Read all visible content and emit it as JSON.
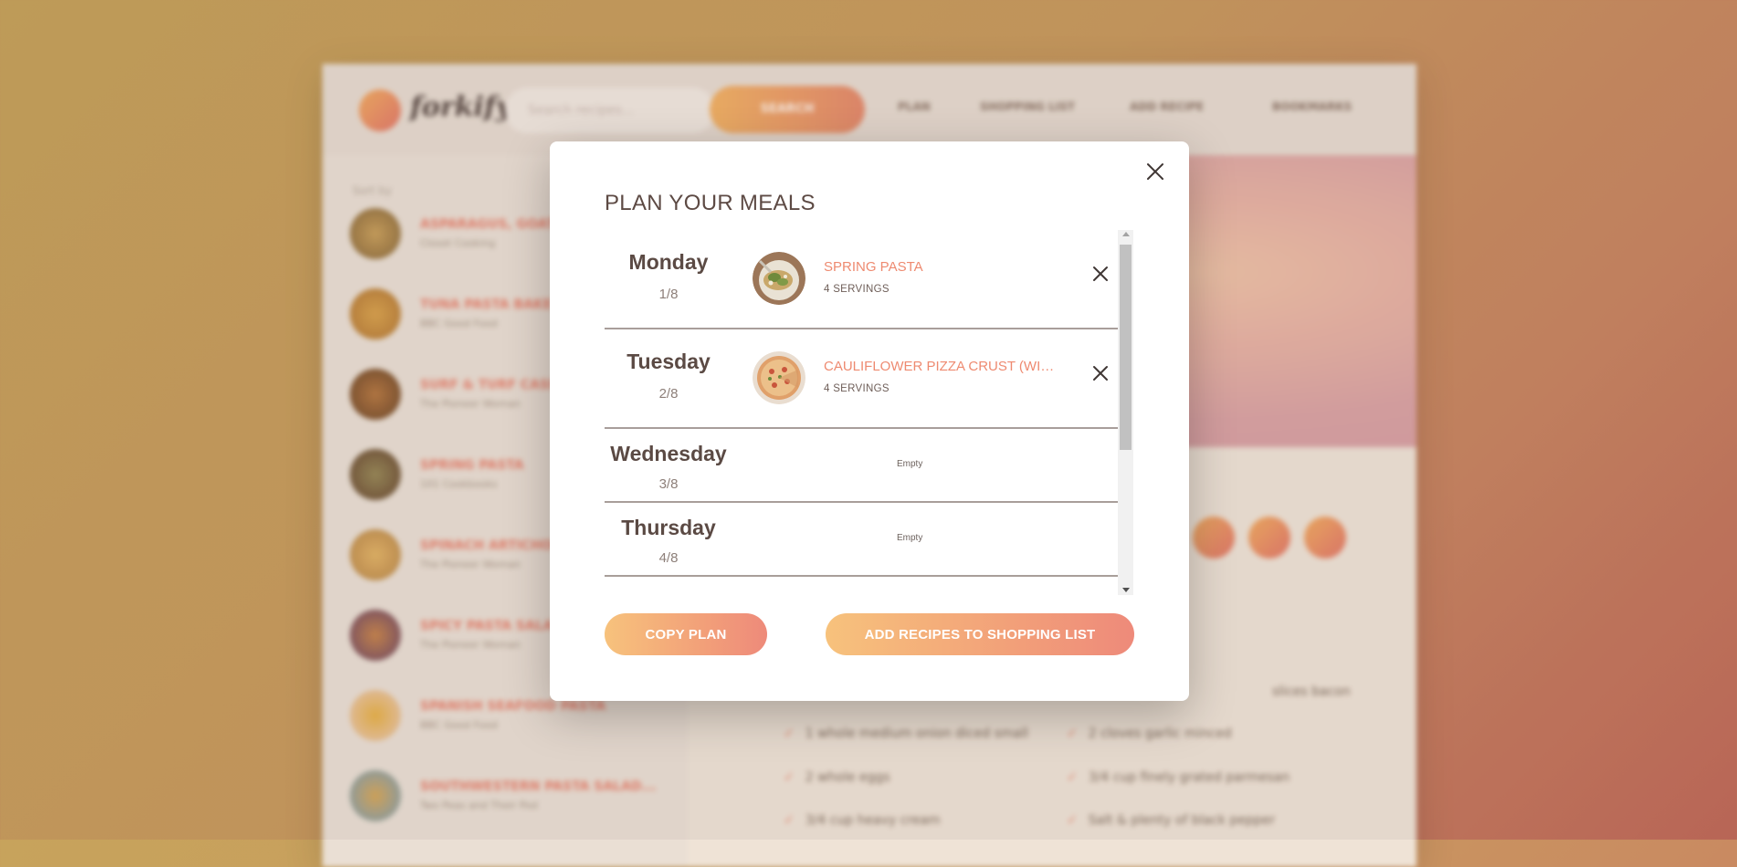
{
  "background": {
    "app_name": "forkify",
    "search_placeholder": "Search recipes...",
    "search_button": "SEARCH",
    "nav": [
      "PLAN",
      "SHOPPING LIST",
      "ADD RECIPE",
      "BOOKMARKS"
    ],
    "sidebar_label": "Sort by",
    "results": [
      {
        "title": "ASPARAGUS, GOAT...",
        "publisher": "Closet Cooking"
      },
      {
        "title": "TUNA PASTA BAKE",
        "publisher": "BBC Good Food"
      },
      {
        "title": "SURF & TURF CASSE...",
        "publisher": "The Pioneer Woman"
      },
      {
        "title": "SPRING PASTA",
        "publisher": "101 Cookbooks"
      },
      {
        "title": "SPINACH ARTICHOKE...",
        "publisher": "The Pioneer Woman"
      },
      {
        "title": "SPICY PASTA SALAD",
        "publisher": "The Pioneer Woman"
      },
      {
        "title": "SPANISH SEAFOOD PASTA",
        "publisher": "BBC Good Food"
      },
      {
        "title": "SOUTHWESTERN PASTA SALAD...",
        "publisher": "Two Peas and Their Pod"
      }
    ],
    "ingredients": [
      "1 whole medium onion diced small",
      "2 whole eggs",
      "3/4 cup heavy cream",
      "2 cloves garlic minced",
      "3/4 cup finely grated parmesan",
      "Salt & plenty of black pepper",
      "slices bacon"
    ]
  },
  "modal": {
    "title": "PLAN YOUR MEALS",
    "days": [
      {
        "day": "Monday",
        "date": "1/8",
        "recipe": "SPRING PASTA",
        "servings": "4 SERVINGS",
        "image": "pasta-image"
      },
      {
        "day": "Tuesday",
        "date": "2/8",
        "recipe": "CAULIFLOWER PIZZA CRUST (WITH BBQ CHICKEN PIZZA)",
        "servings": "4 SERVINGS",
        "image": "pizza-image"
      },
      {
        "day": "Wednesday",
        "date": "3/8",
        "empty_label": "Empty"
      },
      {
        "day": "Thursday",
        "date": "4/8",
        "empty_label": "Empty"
      }
    ],
    "copy_button": "COPY PLAN",
    "shopping_button": "ADD RECIPES TO SHOPPING LIST"
  },
  "colors": {
    "accent": "#ee8a70",
    "button_gradient_start": "#f7c27c",
    "button_gradient_end": "#ee8a7a",
    "heading": "#5d4a44"
  }
}
